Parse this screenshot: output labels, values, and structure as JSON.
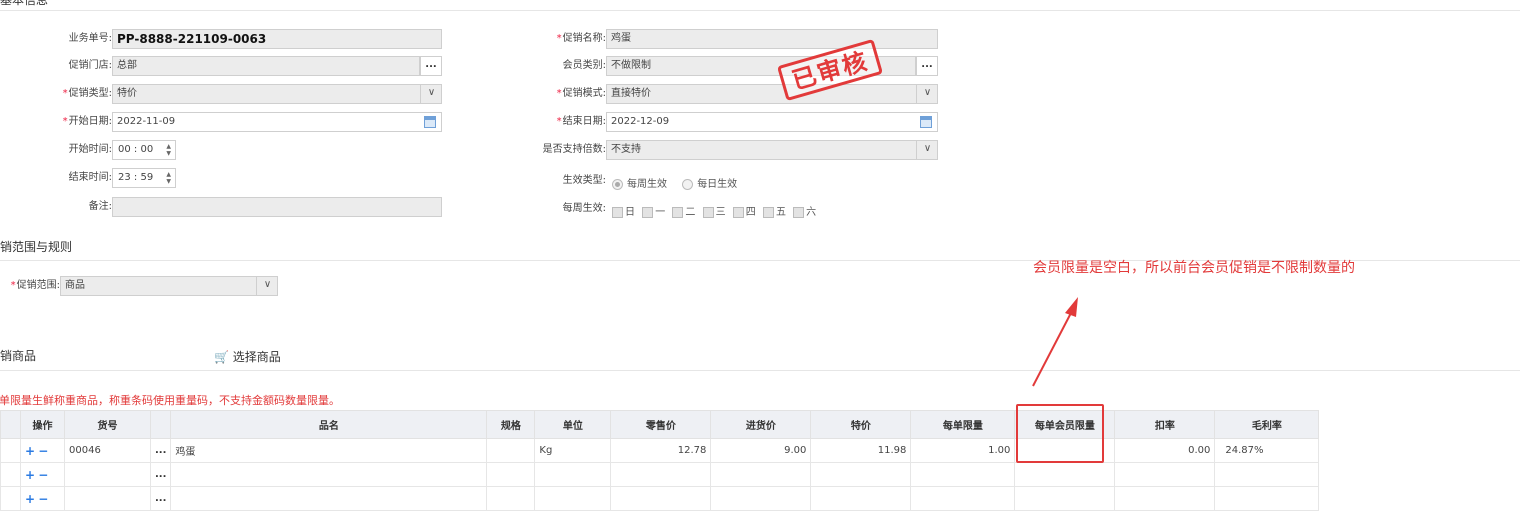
{
  "header": {
    "title": "基本信息"
  },
  "form": {
    "business_no": {
      "label": "业务单号:",
      "value": "PP-8888-221109-0063"
    },
    "store": {
      "label": "促销门店:",
      "value": "总部"
    },
    "promo_type": {
      "label": "促销类型:",
      "value": "特价"
    },
    "start_date": {
      "label": "开始日期:",
      "value": "2022-11-09"
    },
    "start_time": {
      "label": "开始时间:",
      "value": "00 : 00"
    },
    "end_time": {
      "label": "结束时间:",
      "value": "23 : 59"
    },
    "remark": {
      "label": "备注:",
      "value": ""
    },
    "promo_name": {
      "label": "促销名称:",
      "value": "鸡蛋"
    },
    "member_type": {
      "label": "会员类别:",
      "value": "不做限制"
    },
    "promo_mode": {
      "label": "促销模式:",
      "value": "直接特价"
    },
    "end_date": {
      "label": "结束日期:",
      "value": "2022-12-09"
    },
    "installment": {
      "label": "是否支持倍数:",
      "value": "不支持"
    },
    "effect_type": {
      "label": "生效类型:",
      "options": [
        "每周生效",
        "每日生效"
      ],
      "selected": "每周生效"
    },
    "weekly": {
      "label": "每周生效:",
      "days": [
        "日",
        "一",
        "二",
        "三",
        "四",
        "五",
        "六"
      ]
    },
    "status_stamp": "已审核"
  },
  "scope": {
    "title": "促销范围与规则",
    "range_label": "促销范围:",
    "range_value": "商品"
  },
  "goods": {
    "title": "促销商品",
    "select_button": "选择商品",
    "warning": "每单限量生鲜称重商品，称重条码使用重量码，不支持金额码数量限量。",
    "columns": [
      "操作",
      "货号",
      "品名",
      "规格",
      "单位",
      "零售价",
      "进货价",
      "特价",
      "每单限量",
      "每单会员限量",
      "扣率",
      "毛利率"
    ],
    "rows": [
      {
        "code": "00046",
        "name": "鸡蛋",
        "spec": "",
        "unit": "Kg",
        "retail": "12.78",
        "cost": "9.00",
        "special": "11.98",
        "limit": "1.00",
        "member_limit": "",
        "discount": "0.00",
        "margin": "24.87%"
      },
      {
        "code": "",
        "name": "",
        "spec": "",
        "unit": "",
        "retail": "",
        "cost": "",
        "special": "",
        "limit": "",
        "member_limit": "",
        "discount": "",
        "margin": ""
      },
      {
        "code": "",
        "name": "",
        "spec": "",
        "unit": "",
        "retail": "",
        "cost": "",
        "special": "",
        "limit": "",
        "member_limit": "",
        "discount": "",
        "margin": ""
      }
    ],
    "plus": "+",
    "minus": "−",
    "dots": "..."
  },
  "annotation": {
    "text": "会员限量是空白，所以前台会员促销是不限制数量的",
    "color": "#e23a3a"
  }
}
